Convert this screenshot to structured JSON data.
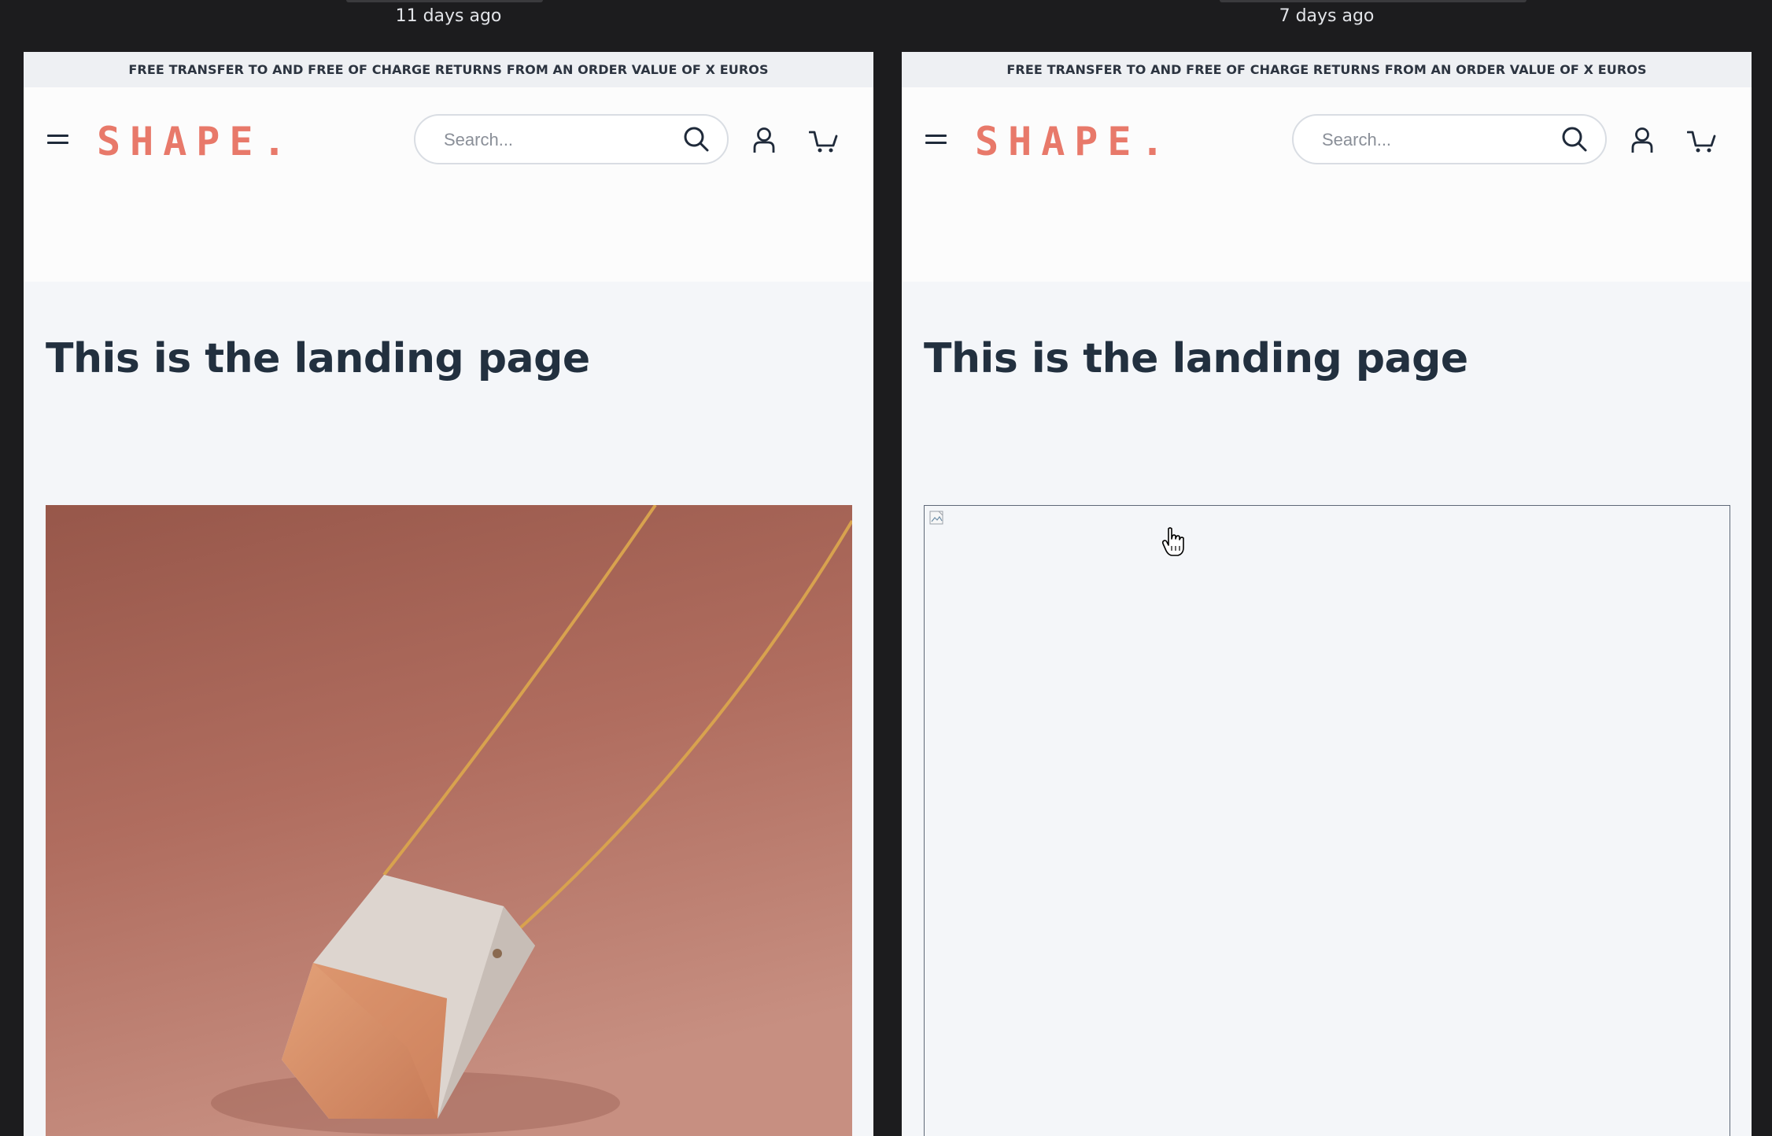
{
  "versions": [
    {
      "timestamp": "11 days ago",
      "banner": "FREE TRANSFER TO AND FREE OF CHARGE RETURNS FROM AN ORDER VALUE OF X EUROS",
      "logo": "SHAPE.",
      "search_placeholder": "Search...",
      "headline": "This is the landing page",
      "hero_image": "pendant-necklace-photo"
    },
    {
      "timestamp": "7 days ago",
      "banner": "FREE TRANSFER TO AND FREE OF CHARGE RETURNS FROM AN ORDER VALUE OF X EUROS",
      "logo": "SHAPE.",
      "search_placeholder": "Search...",
      "headline": "This is the landing page",
      "hero_image": "broken-image"
    }
  ],
  "colors": {
    "page_bg": "#1c1c1e",
    "brand": "#e8796a",
    "text_dark": "#22303f",
    "content_bg": "#f4f6f9",
    "header_bg": "#fcfcfc"
  },
  "icons": [
    "menu-icon",
    "search-icon",
    "user-icon",
    "cart-icon",
    "broken-image-icon",
    "pointer-hand-cursor-icon"
  ]
}
